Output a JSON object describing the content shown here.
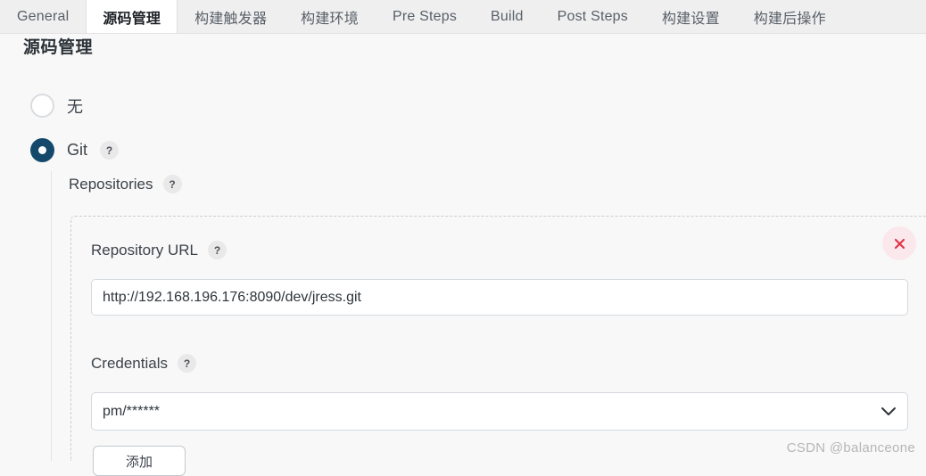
{
  "tabs": [
    {
      "label": "General",
      "active": false
    },
    {
      "label": "源码管理",
      "active": true
    },
    {
      "label": "构建触发器",
      "active": false
    },
    {
      "label": "构建环境",
      "active": false
    },
    {
      "label": "Pre Steps",
      "active": false
    },
    {
      "label": "Build",
      "active": false
    },
    {
      "label": "Post Steps",
      "active": false
    },
    {
      "label": "构建设置",
      "active": false
    },
    {
      "label": "构建后操作",
      "active": false
    }
  ],
  "page": {
    "heading": "源码管理"
  },
  "scm": {
    "options": [
      {
        "label": "无",
        "selected": false,
        "help": false
      },
      {
        "label": "Git",
        "selected": true,
        "help": true
      }
    ],
    "none_label": "无",
    "git_label": "Git",
    "help_glyph": "?"
  },
  "repositories": {
    "label": "Repositories",
    "repo_url": {
      "label": "Repository URL",
      "value": "http://192.168.196.176:8090/dev/jress.git",
      "placeholder": ""
    },
    "credentials": {
      "label": "Credentials",
      "value": "pm/******",
      "chevron": "chevron-down-icon"
    },
    "delete_button": {
      "icon": "close-icon",
      "color": "#e0344a",
      "background": "#fae8ec"
    },
    "add_button": {
      "label": "添加"
    }
  },
  "watermark": {
    "text": "CSDN @balanceone"
  },
  "colors": {
    "accent": "#15496b",
    "tabbar_bg": "#efeff0",
    "page_bg": "#f8f8f8",
    "danger": "#e0344a"
  }
}
